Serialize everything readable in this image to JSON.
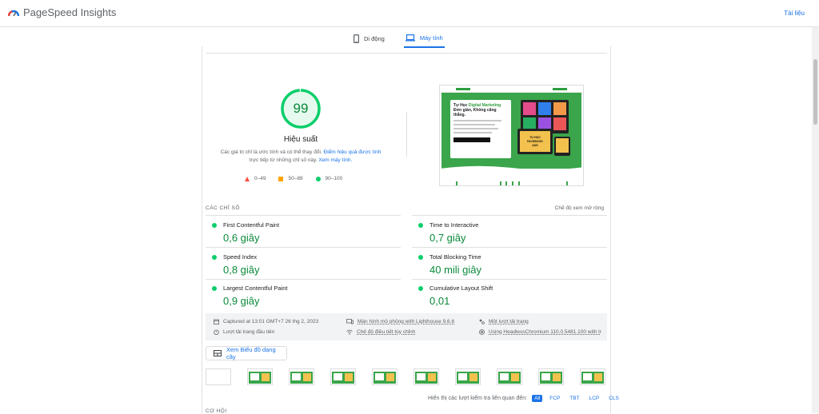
{
  "header": {
    "app_name": "PageSpeed Insights",
    "docs_link": "Tài liệu"
  },
  "tabs": [
    {
      "label": "Di động",
      "icon": "phone-icon",
      "active": false
    },
    {
      "label": "Máy tính",
      "icon": "laptop-icon",
      "active": true
    }
  ],
  "performance": {
    "score": "99",
    "score_fraction": 0.99,
    "title": "Hiệu suất",
    "desc_part1": "Các giá trị chỉ là ước tính và có thể thay đổi. ",
    "desc_link1": "Điểm hiệu quả được tính",
    "desc_part2": " trực tiếp từ những chỉ số này. ",
    "desc_link2": "Xem máy tính.",
    "color": "#0cce6b"
  },
  "legend": [
    {
      "label": "0–49",
      "shape": "triangle",
      "color": "#ff4e42"
    },
    {
      "label": "50–89",
      "shape": "square",
      "color": "#ffa400"
    },
    {
      "label": "90–100",
      "shape": "circle",
      "color": "#0cce6b"
    }
  ],
  "screenshot_preview": {
    "headline_1": "Tự Học ",
    "headline_2": "Digital Marketing",
    "headline_3": "Đơn giản, Không căng thẳng.",
    "book_title": "TỰ HỌC FACEBOOK ADS"
  },
  "metrics_section": {
    "label": "CÁC CHỈ SỐ",
    "toggle": "Chế độ xem mở rộng"
  },
  "metrics": [
    {
      "name": "First Contentful Paint",
      "value": "0,6 giây"
    },
    {
      "name": "Time to Interactive",
      "value": "0,7 giây"
    },
    {
      "name": "Speed Index",
      "value": "0,8 giây"
    },
    {
      "name": "Total Blocking Time",
      "value": "40 mili giây"
    },
    {
      "name": "Largest Contentful Paint",
      "value": "0,9 giây"
    },
    {
      "name": "Cumulative Layout Shift",
      "value": "0,01"
    }
  ],
  "runtime": {
    "captured": "Captured at 13:01 GMT+7 26 thg 2, 2023",
    "emulated": "Màn hình mô phỏng with Lighthouse 9.6.6",
    "single_load": "Một lượt tải trang",
    "initial_load": "Lượt tải trang đầu tiên",
    "throttling": "Chế độ điều tiết tùy chỉnh",
    "browser": "Using HeadlessChromium 110.0.5481.100 with lr"
  },
  "treemap": {
    "label": "Xem Biểu đồ dạng cây"
  },
  "audit_filter": {
    "label": "Hiển thị các lượt kiểm tra liên quan đến:",
    "chips": [
      {
        "label": "All",
        "active": true
      },
      {
        "label": "FCP",
        "active": false
      },
      {
        "label": "TBT",
        "active": false
      },
      {
        "label": "LCP",
        "active": false
      },
      {
        "label": "CLS",
        "active": false
      }
    ]
  },
  "opportunities_label": "CƠ HỘI"
}
